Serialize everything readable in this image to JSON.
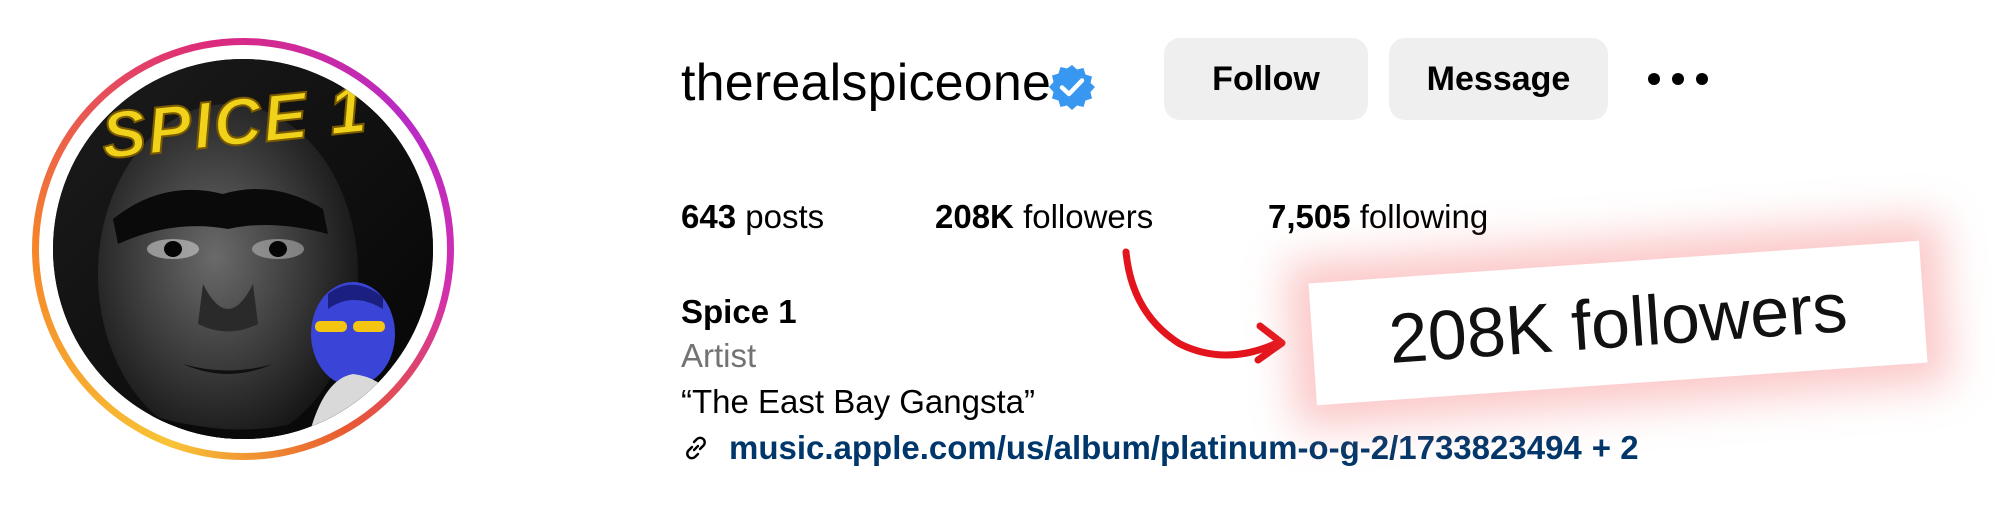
{
  "profile": {
    "username": "therealspiceone",
    "verified_icon": "verified-badge-icon",
    "avatar_text": "SPICE 1"
  },
  "actions": {
    "follow_label": "Follow",
    "message_label": "Message",
    "more_icon": "more-options-icon"
  },
  "stats": {
    "posts_count": "643",
    "posts_label": "posts",
    "followers_count": "208K",
    "followers_label": "followers",
    "following_count": "7,505",
    "following_label": "following"
  },
  "bio": {
    "name": "Spice 1",
    "category": "Artist",
    "text": "“The East Bay Gangsta”",
    "link_icon": "link-icon",
    "link_text": "music.apple.com/us/album/platinum-o-g-2/1733823494",
    "link_extra": "+ 2"
  },
  "callout": {
    "text": "208K followers",
    "arrow_icon": "curved-arrow-icon"
  },
  "colors": {
    "link": "#00376b",
    "button_bg": "#efefef",
    "muted_text": "#737373",
    "verified_blue": "#3897f0",
    "arrow_red": "#e3141b",
    "callout_glow": "#f56e6e"
  }
}
